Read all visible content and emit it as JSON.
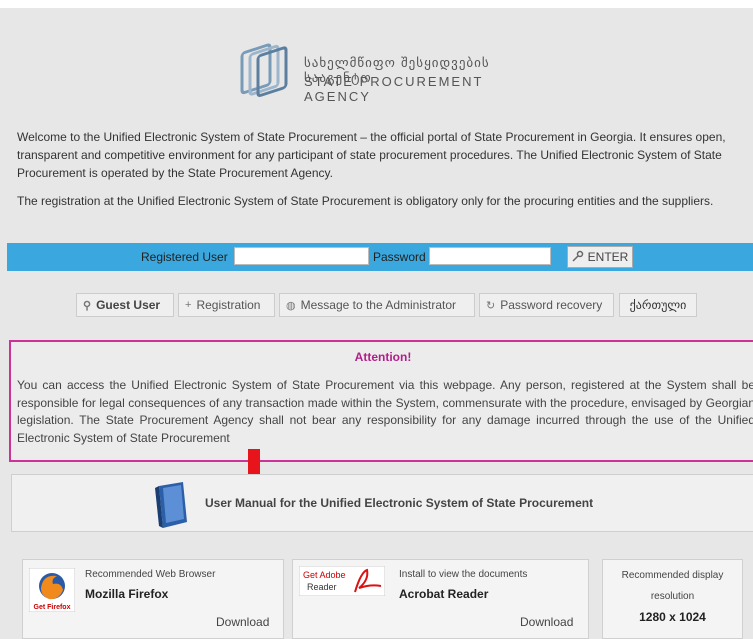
{
  "header": {
    "agency_name_ka": "სახელმწიფო შესყიდვების სააგენტო",
    "agency_name_en": "STATE PROCUREMENT AGENCY"
  },
  "intro": {
    "paragraph1": "Welcome to the Unified Electronic System of State Procurement – the official portal of State Procurement in Georgia. It ensures open, transparent and competitive environment for any participant of state procurement procedures. The Unified Electronic System of State Procurement is operated by the State Procurement Agency.",
    "paragraph2": "The registration at the Unified Electronic System of State Procurement is obligatory only for the procuring entities and the suppliers."
  },
  "login": {
    "user_label": "Registered User",
    "password_label": "Password",
    "enter_label": "ENTER",
    "bar_color": "#3aa7de"
  },
  "nav": {
    "guest": "Guest User",
    "registration": "Registration",
    "message_admin": "Message to the Administrator",
    "password_recovery": "Password recovery",
    "language": "ქართული"
  },
  "attention": {
    "title": "Attention!",
    "text": "You can access the Unified Electronic System of State Procurement via this webpage. Any person, registered at the System shall be responsible for legal consequences of any transaction made within the System, commensurate with the procedure, envisaged by Georgian legislation. The State Procurement Agency shall not bear any responsibility for any damage incurred through the use of the Unified Electronic System of State Procurement",
    "border_color": "#cc3399"
  },
  "manual": {
    "label": "User Manual for the Unified Electronic System of State Procurement"
  },
  "cards": {
    "firefox": {
      "caption": "Recommended Web Browser",
      "name": "Mozilla Firefox",
      "download": "Download",
      "logo_text": "Get Firefox"
    },
    "acrobat": {
      "caption": "Install to view the documents",
      "name": "Acrobat Reader",
      "download": "Download",
      "logo_line1": "Get Adobe",
      "logo_line2": "Reader"
    },
    "resolution": {
      "caption1": "Recommended display",
      "caption2": "resolution",
      "value": "1280 x 1024"
    }
  }
}
